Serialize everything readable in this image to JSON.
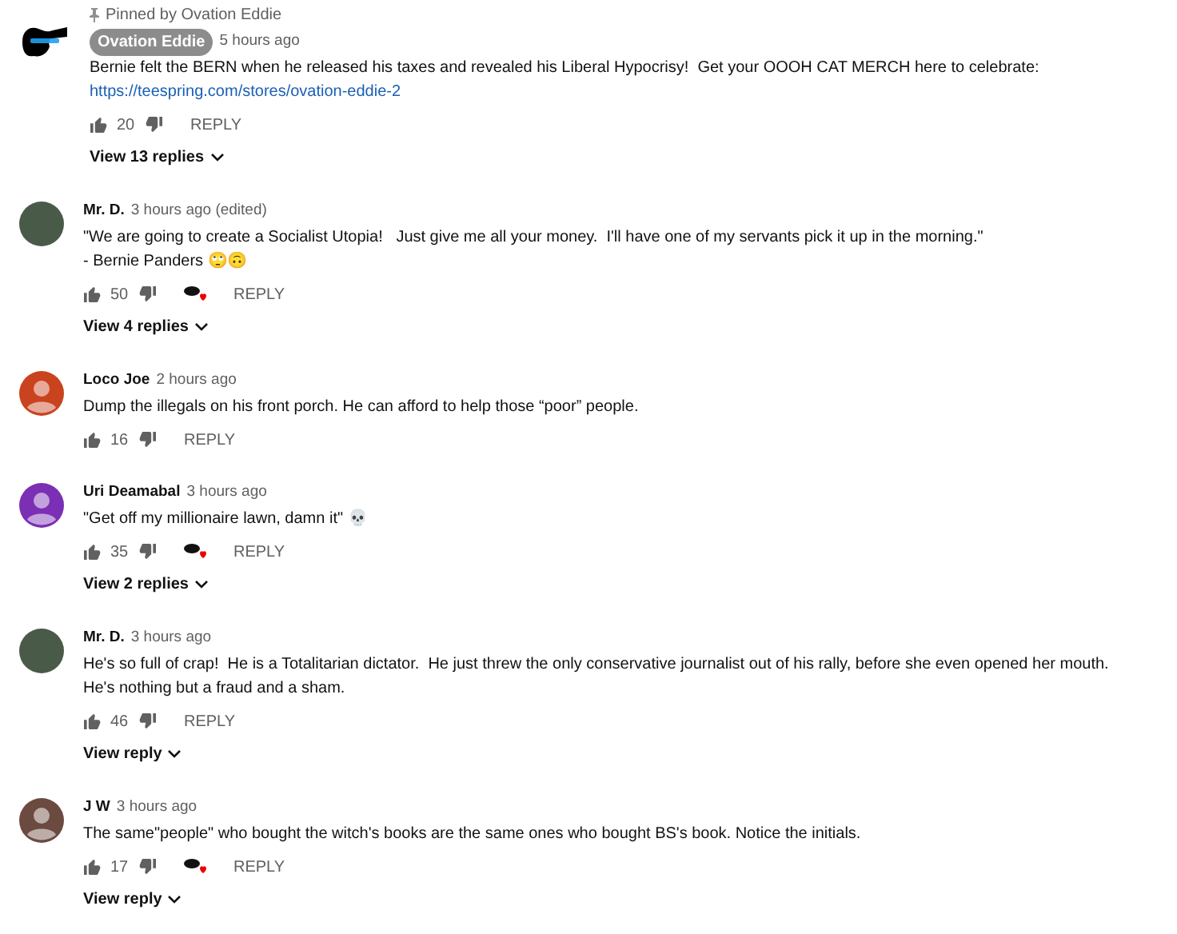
{
  "comments": [
    {
      "pinned": "Pinned by Ovation Eddie",
      "avatar": {
        "kind": "logo",
        "color": "#000000"
      },
      "author": "Ovation Eddie",
      "owner": true,
      "time": "5 hours ago",
      "lines": [
        "Bernie felt the BERN when he released his taxes and revealed his Liberal Hypocrisy!  Get your OOOH CAT MERCH here to celebrate:"
      ],
      "link": "https://teespring.com/stores/ovation-eddie-2",
      "likes": "20",
      "hearted": false,
      "reply": "REPLY",
      "view_replies": "View 13 replies"
    },
    {
      "avatar": {
        "kind": "photo",
        "color": "#4a5a48"
      },
      "author": "Mr. D.",
      "owner": false,
      "time": "3 hours ago (edited)",
      "lines": [
        "\"We are going to create a Socialist Utopia!   Just give me all your money.  I'll have one of my servants pick it up in the morning.\"",
        "- Bernie Panders 🙄🙃"
      ],
      "likes": "50",
      "hearted": true,
      "reply": "REPLY",
      "view_replies": "View 4 replies"
    },
    {
      "avatar": {
        "kind": "silhouette",
        "color": "#c9431f"
      },
      "author": "Loco Joe",
      "owner": false,
      "time": "2 hours ago",
      "lines": [
        "Dump the illegals on his front porch. He can afford to help those “poor” people."
      ],
      "likes": "16",
      "hearted": false,
      "reply": "REPLY"
    },
    {
      "avatar": {
        "kind": "silhouette",
        "color": "#7b2fb5"
      },
      "author": "Uri Deamabal",
      "owner": false,
      "time": "3 hours ago",
      "lines": [
        "\"Get off my millionaire lawn, damn it\" 💀"
      ],
      "likes": "35",
      "hearted": true,
      "reply": "REPLY",
      "view_replies": "View 2 replies"
    },
    {
      "avatar": {
        "kind": "photo",
        "color": "#4a5a48"
      },
      "author": "Mr. D.",
      "owner": false,
      "time": "3 hours ago",
      "lines": [
        "He's so full of crap!  He is a Totalitarian dictator.  He just threw the only conservative journalist out of his rally, before she even opened her mouth.",
        "He's nothing but a fraud and a sham."
      ],
      "likes": "46",
      "hearted": false,
      "reply": "REPLY",
      "view_replies": "View reply"
    },
    {
      "avatar": {
        "kind": "silhouette",
        "color": "#6b4a40"
      },
      "author": "J W",
      "owner": false,
      "time": "3 hours ago",
      "lines": [
        "The same\"people\" who bought the witch's books are the same ones who bought BS's book. Notice the initials."
      ],
      "likes": "17",
      "hearted": true,
      "reply": "REPLY",
      "view_replies": "View reply"
    }
  ]
}
